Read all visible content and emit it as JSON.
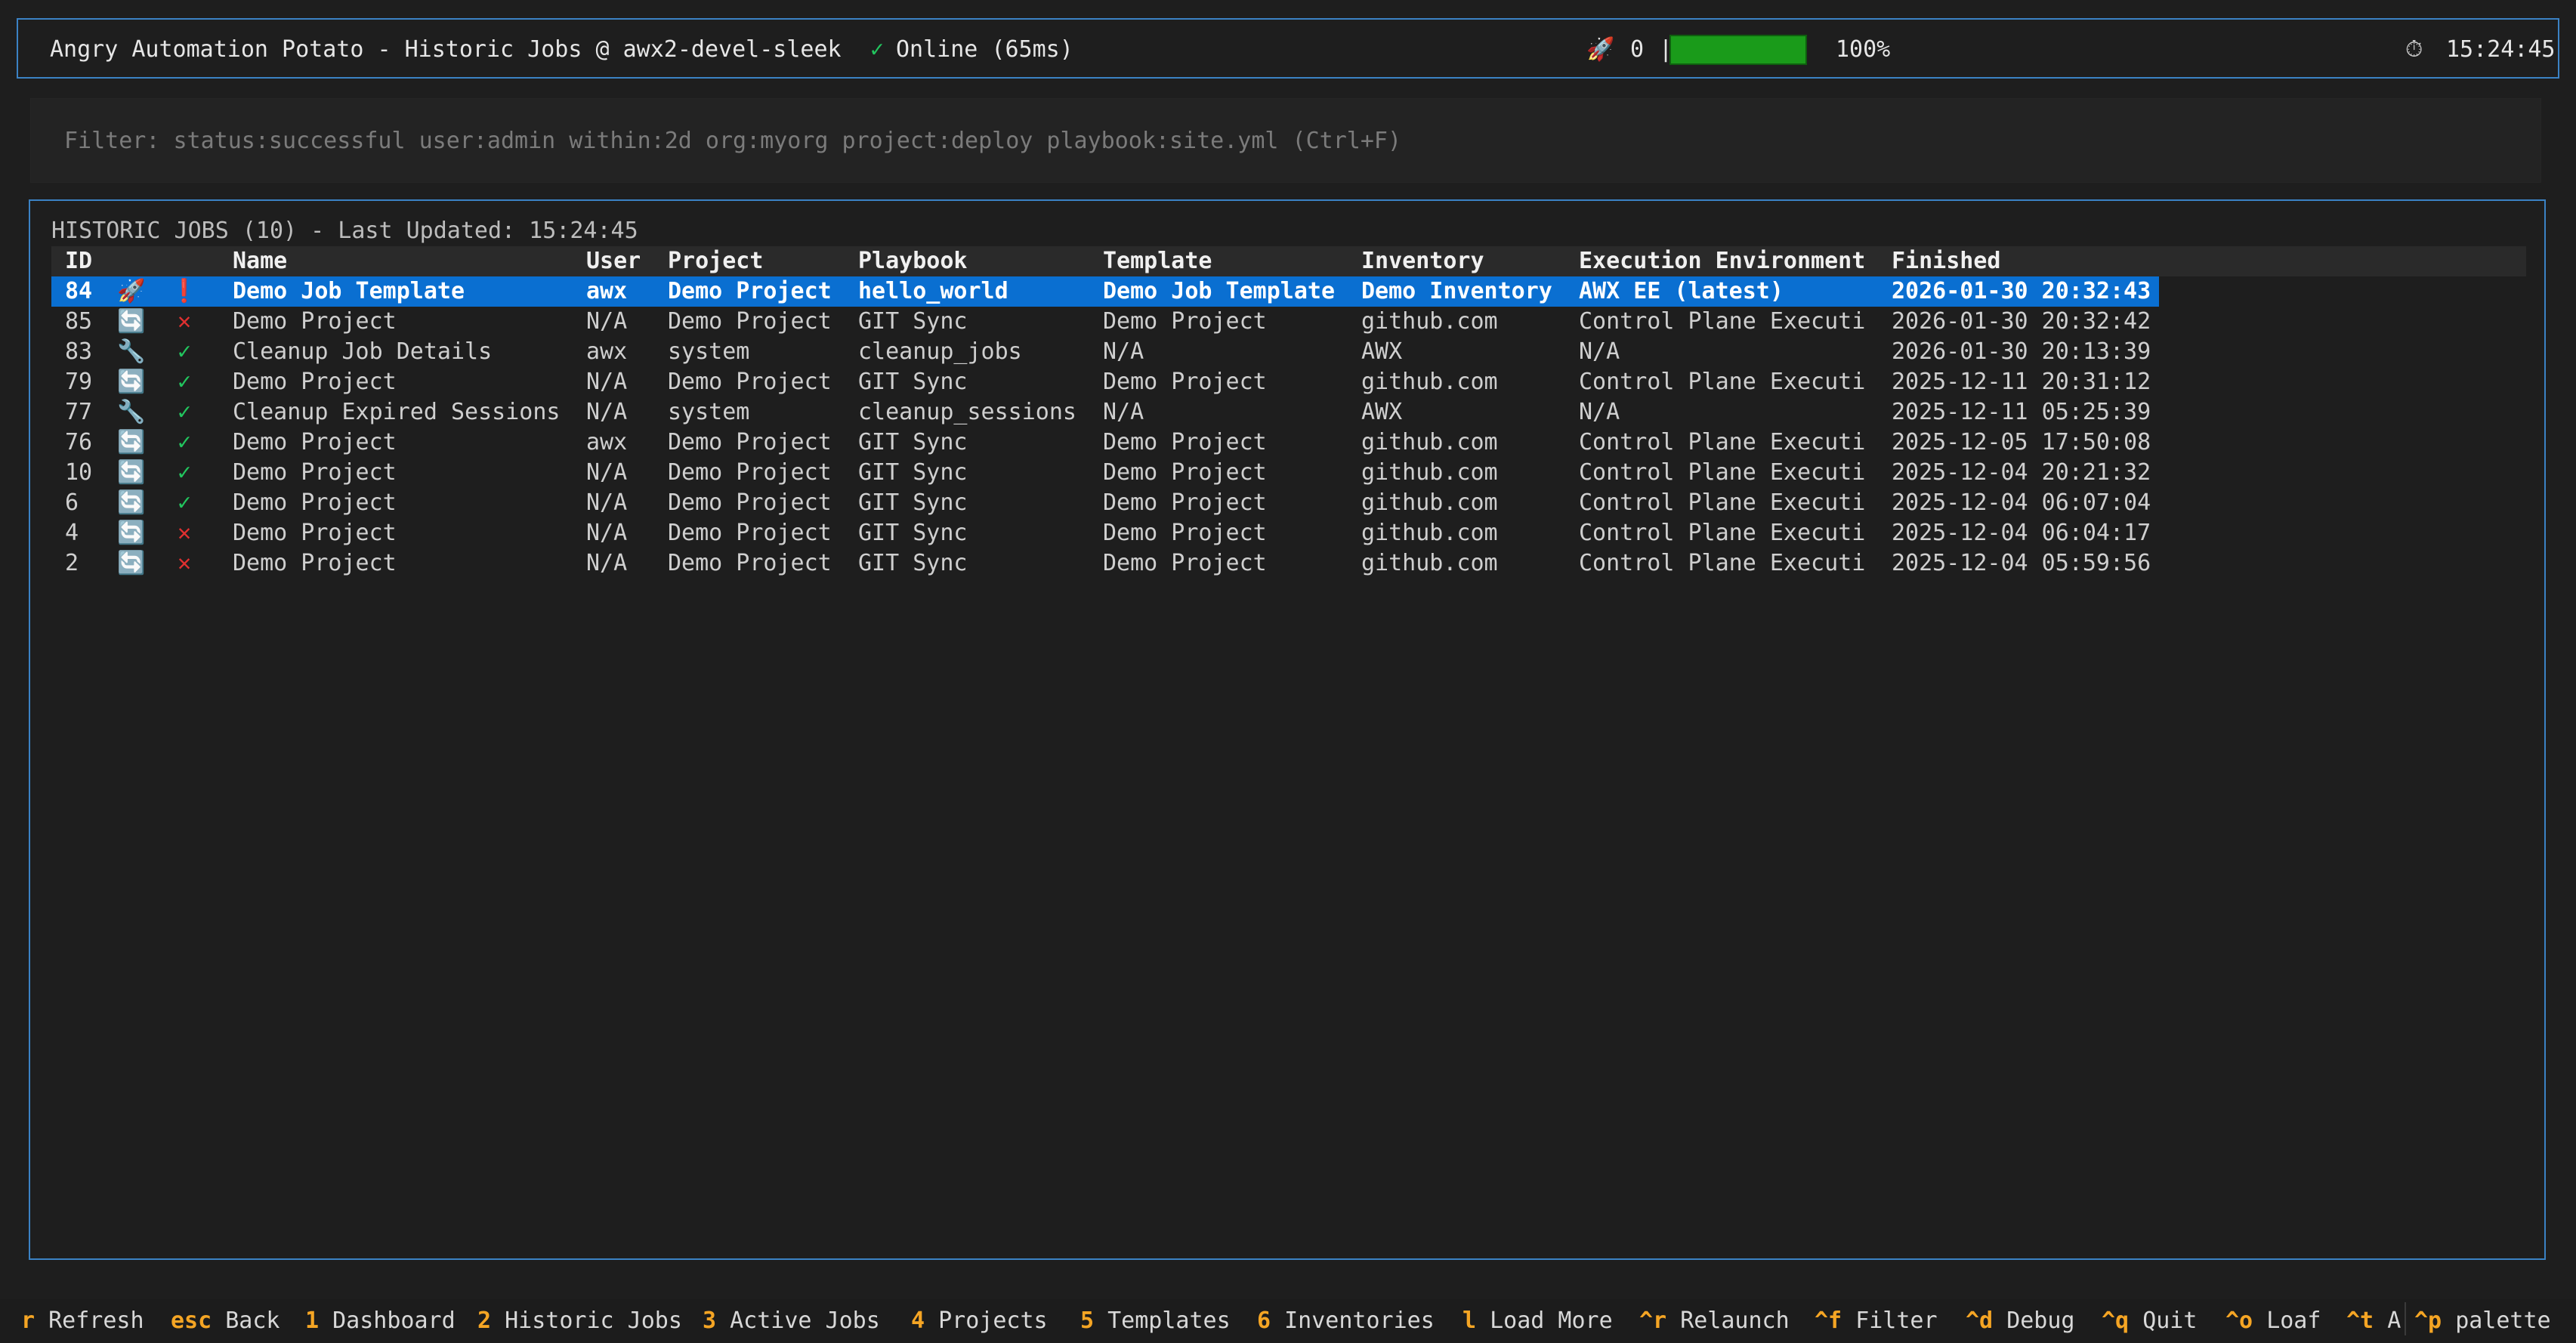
{
  "header": {
    "app_title": "Angry Automation Potato - Historic Jobs @ awx2-devel-sleek",
    "status_check": "✓",
    "status_text": "Online (65ms)",
    "running_icon": "rocket-icon",
    "running_glyph": "🚀",
    "running_count": "0",
    "separator": "|",
    "capacity_value": 1.0,
    "capacity_percent": "100%",
    "clock_icon": "stopwatch-icon",
    "clock_glyph": "⏱",
    "clock": "15:24:45",
    "colors": {
      "accent": "#3b82c4",
      "progress": "#1a9b1a",
      "online": "#22c55e"
    }
  },
  "filter": {
    "text": "Filter: status:successful user:admin within:2d org:myorg project:deploy playbook:site.yml (Ctrl+F)"
  },
  "panel": {
    "title": "HISTORIC JOBS (10) - Last Updated: 15:24:45"
  },
  "table": {
    "columns": {
      "id": "ID",
      "name": "Name",
      "user": "User",
      "project": "Project",
      "playbook": "Playbook",
      "template": "Template",
      "inventory": "Inventory",
      "ee": "Execution Environment",
      "finished": "Finished"
    },
    "rows": [
      {
        "id": "84",
        "type_icon": "🚀",
        "type_name": "rocket-icon",
        "status_icon": "❗",
        "status_name": "exclamation-icon",
        "status": "warn",
        "name": "Demo Job Template",
        "user": "awx",
        "project": "Demo Project",
        "playbook": "hello_world",
        "template": "Demo Job Template",
        "inventory": "Demo Inventory",
        "ee": "AWX EE (latest)",
        "finished": "2026-01-30 20:32:43"
      },
      {
        "id": "85",
        "type_icon": "🔄",
        "type_name": "sync-icon",
        "status_icon": "✕",
        "status_name": "cross-icon",
        "status": "fail",
        "name": "Demo Project",
        "user": "N/A",
        "project": "Demo Project",
        "playbook": "GIT Sync",
        "template": "Demo Project",
        "inventory": "github.com",
        "ee": "Control Plane Executi",
        "finished": "2026-01-30 20:32:42"
      },
      {
        "id": "83",
        "type_icon": "🔧",
        "type_name": "wrench-icon",
        "status_icon": "✓",
        "status_name": "check-icon",
        "status": "ok",
        "name": "Cleanup Job Details",
        "user": "awx",
        "project": "system",
        "playbook": "cleanup_jobs",
        "template": "N/A",
        "inventory": "AWX",
        "ee": "N/A",
        "finished": "2026-01-30 20:13:39"
      },
      {
        "id": "79",
        "type_icon": "🔄",
        "type_name": "sync-icon",
        "status_icon": "✓",
        "status_name": "check-icon",
        "status": "ok",
        "name": "Demo Project",
        "user": "N/A",
        "project": "Demo Project",
        "playbook": "GIT Sync",
        "template": "Demo Project",
        "inventory": "github.com",
        "ee": "Control Plane Executi",
        "finished": "2025-12-11 20:31:12"
      },
      {
        "id": "77",
        "type_icon": "🔧",
        "type_name": "wrench-icon",
        "status_icon": "✓",
        "status_name": "check-icon",
        "status": "ok",
        "name": "Cleanup Expired Sessions",
        "user": "N/A",
        "project": "system",
        "playbook": "cleanup_sessions",
        "template": "N/A",
        "inventory": "AWX",
        "ee": "N/A",
        "finished": "2025-12-11 05:25:39"
      },
      {
        "id": "76",
        "type_icon": "🔄",
        "type_name": "sync-icon",
        "status_icon": "✓",
        "status_name": "check-icon",
        "status": "ok",
        "name": "Demo Project",
        "user": "awx",
        "project": "Demo Project",
        "playbook": "GIT Sync",
        "template": "Demo Project",
        "inventory": "github.com",
        "ee": "Control Plane Executi",
        "finished": "2025-12-05 17:50:08"
      },
      {
        "id": "10",
        "type_icon": "🔄",
        "type_name": "sync-icon",
        "status_icon": "✓",
        "status_name": "check-icon",
        "status": "ok",
        "name": "Demo Project",
        "user": "N/A",
        "project": "Demo Project",
        "playbook": "GIT Sync",
        "template": "Demo Project",
        "inventory": "github.com",
        "ee": "Control Plane Executi",
        "finished": "2025-12-04 20:21:32"
      },
      {
        "id": "6",
        "type_icon": "🔄",
        "type_name": "sync-icon",
        "status_icon": "✓",
        "status_name": "check-icon",
        "status": "ok",
        "name": "Demo Project",
        "user": "N/A",
        "project": "Demo Project",
        "playbook": "GIT Sync",
        "template": "Demo Project",
        "inventory": "github.com",
        "ee": "Control Plane Executi",
        "finished": "2025-12-04 06:07:04"
      },
      {
        "id": "4",
        "type_icon": "🔄",
        "type_name": "sync-icon",
        "status_icon": "✕",
        "status_name": "cross-icon",
        "status": "fail",
        "name": "Demo Project",
        "user": "N/A",
        "project": "Demo Project",
        "playbook": "GIT Sync",
        "template": "Demo Project",
        "inventory": "github.com",
        "ee": "Control Plane Executi",
        "finished": "2025-12-04 06:04:17"
      },
      {
        "id": "2",
        "type_icon": "🔄",
        "type_name": "sync-icon",
        "status_icon": "✕",
        "status_name": "cross-icon",
        "status": "fail",
        "name": "Demo Project",
        "user": "N/A",
        "project": "Demo Project",
        "playbook": "GIT Sync",
        "template": "Demo Project",
        "inventory": "github.com",
        "ee": "Control Plane Executi",
        "finished": "2025-12-04 05:59:56"
      }
    ]
  },
  "footer": {
    "bindings": [
      {
        "key": "r",
        "label": "Refresh"
      },
      {
        "key": "esc",
        "label": "Back"
      },
      {
        "key": "1",
        "label": "Dashboard"
      },
      {
        "key": "2",
        "label": "Historic Jobs"
      },
      {
        "key": "3",
        "label": "Active Jobs"
      },
      {
        "key": "4",
        "label": "Projects"
      },
      {
        "key": "5",
        "label": "Templates"
      },
      {
        "key": "6",
        "label": "Inventories"
      },
      {
        "key": "l",
        "label": "Load More"
      },
      {
        "key": "^r",
        "label": "Relaunch"
      },
      {
        "key": "^f",
        "label": "Filter"
      },
      {
        "key": "^d",
        "label": "Debug"
      },
      {
        "key": "^q",
        "label": "Quit"
      },
      {
        "key": "^o",
        "label": "Loaf"
      },
      {
        "key": "^t",
        "label": "A"
      },
      {
        "key": "^p",
        "label": "palette"
      }
    ],
    "key_color": "#f5a524"
  }
}
